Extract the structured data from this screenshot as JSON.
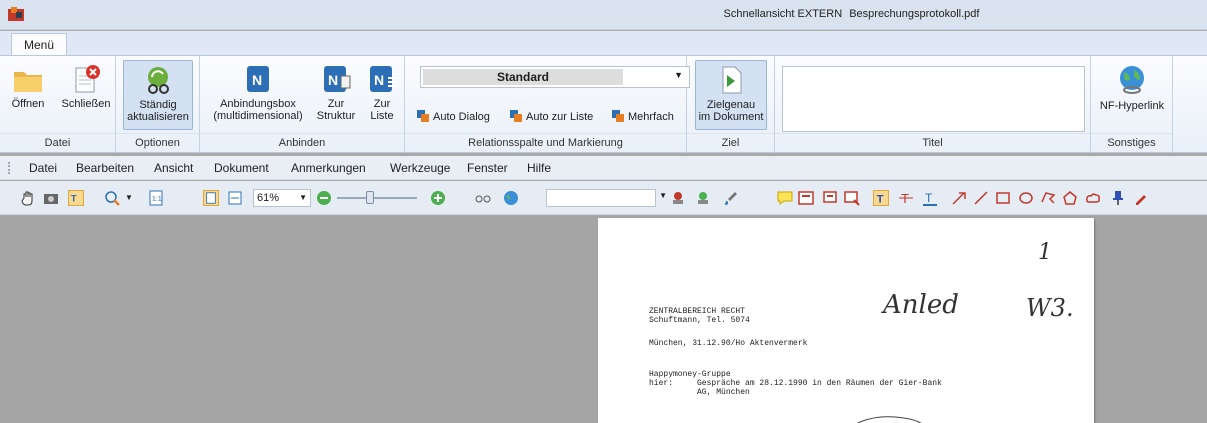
{
  "window": {
    "title": "Schnellansicht EXTERN",
    "filename": "Besprechungsprotokoll.pdf"
  },
  "ribbon_tabs": [
    {
      "label": "Menü"
    }
  ],
  "ribbon": {
    "datei": {
      "label": "Datei",
      "open": "Öffnen",
      "close": "Schließen"
    },
    "optionen": {
      "label": "Optionen",
      "refresh_1": "Ständig",
      "refresh_2": "aktualisieren"
    },
    "anbinden": {
      "label": "Anbinden",
      "box_1": "Anbindungsbox",
      "box_2": "(multidimensional)",
      "struct_1": "Zur",
      "struct_2": "Struktur",
      "list_1": "Zur",
      "list_2": "Liste"
    },
    "relation": {
      "label": "Relationsspalte und Markierung",
      "dropdown_value": "Standard",
      "auto_dialog": "Auto Dialog",
      "auto_list": "Auto zur Liste",
      "multiple": "Mehrfach"
    },
    "ziel": {
      "label": "Ziel",
      "goto_1": "Zielgenau",
      "goto_2": "im Dokument"
    },
    "titel": {
      "label": "Titel"
    },
    "sonstiges": {
      "label": "Sonstiges",
      "hyperlink": "NF-Hyperlink"
    }
  },
  "menubar": [
    "Datei",
    "Bearbeiten",
    "Ansicht",
    "Dokument",
    "Anmerkungen",
    "Werkzeuge",
    "Fenster",
    "Hilfe"
  ],
  "toolbar": {
    "zoom": "61%"
  },
  "document": {
    "lines": [
      "ZENTRALBEREICH RECHT",
      "Schuftmann, Tel. 5074",
      "München, 31.12.90/Ho Aktenvermerk",
      "Happymoney-Gruppe",
      "hier:     Gespräche am 28.12.1990 in den Räumen der Gier-Bank",
      "          AG, München"
    ],
    "handwriting": {
      "number": "1",
      "word": "Anled",
      "initials": "W3."
    }
  },
  "colors": {
    "ribbon_bg": "#fbfcfe",
    "titlebar_bg": "#d9e3f0",
    "doc_bg": "#a5a5a5",
    "selected": "#f9d88f"
  }
}
